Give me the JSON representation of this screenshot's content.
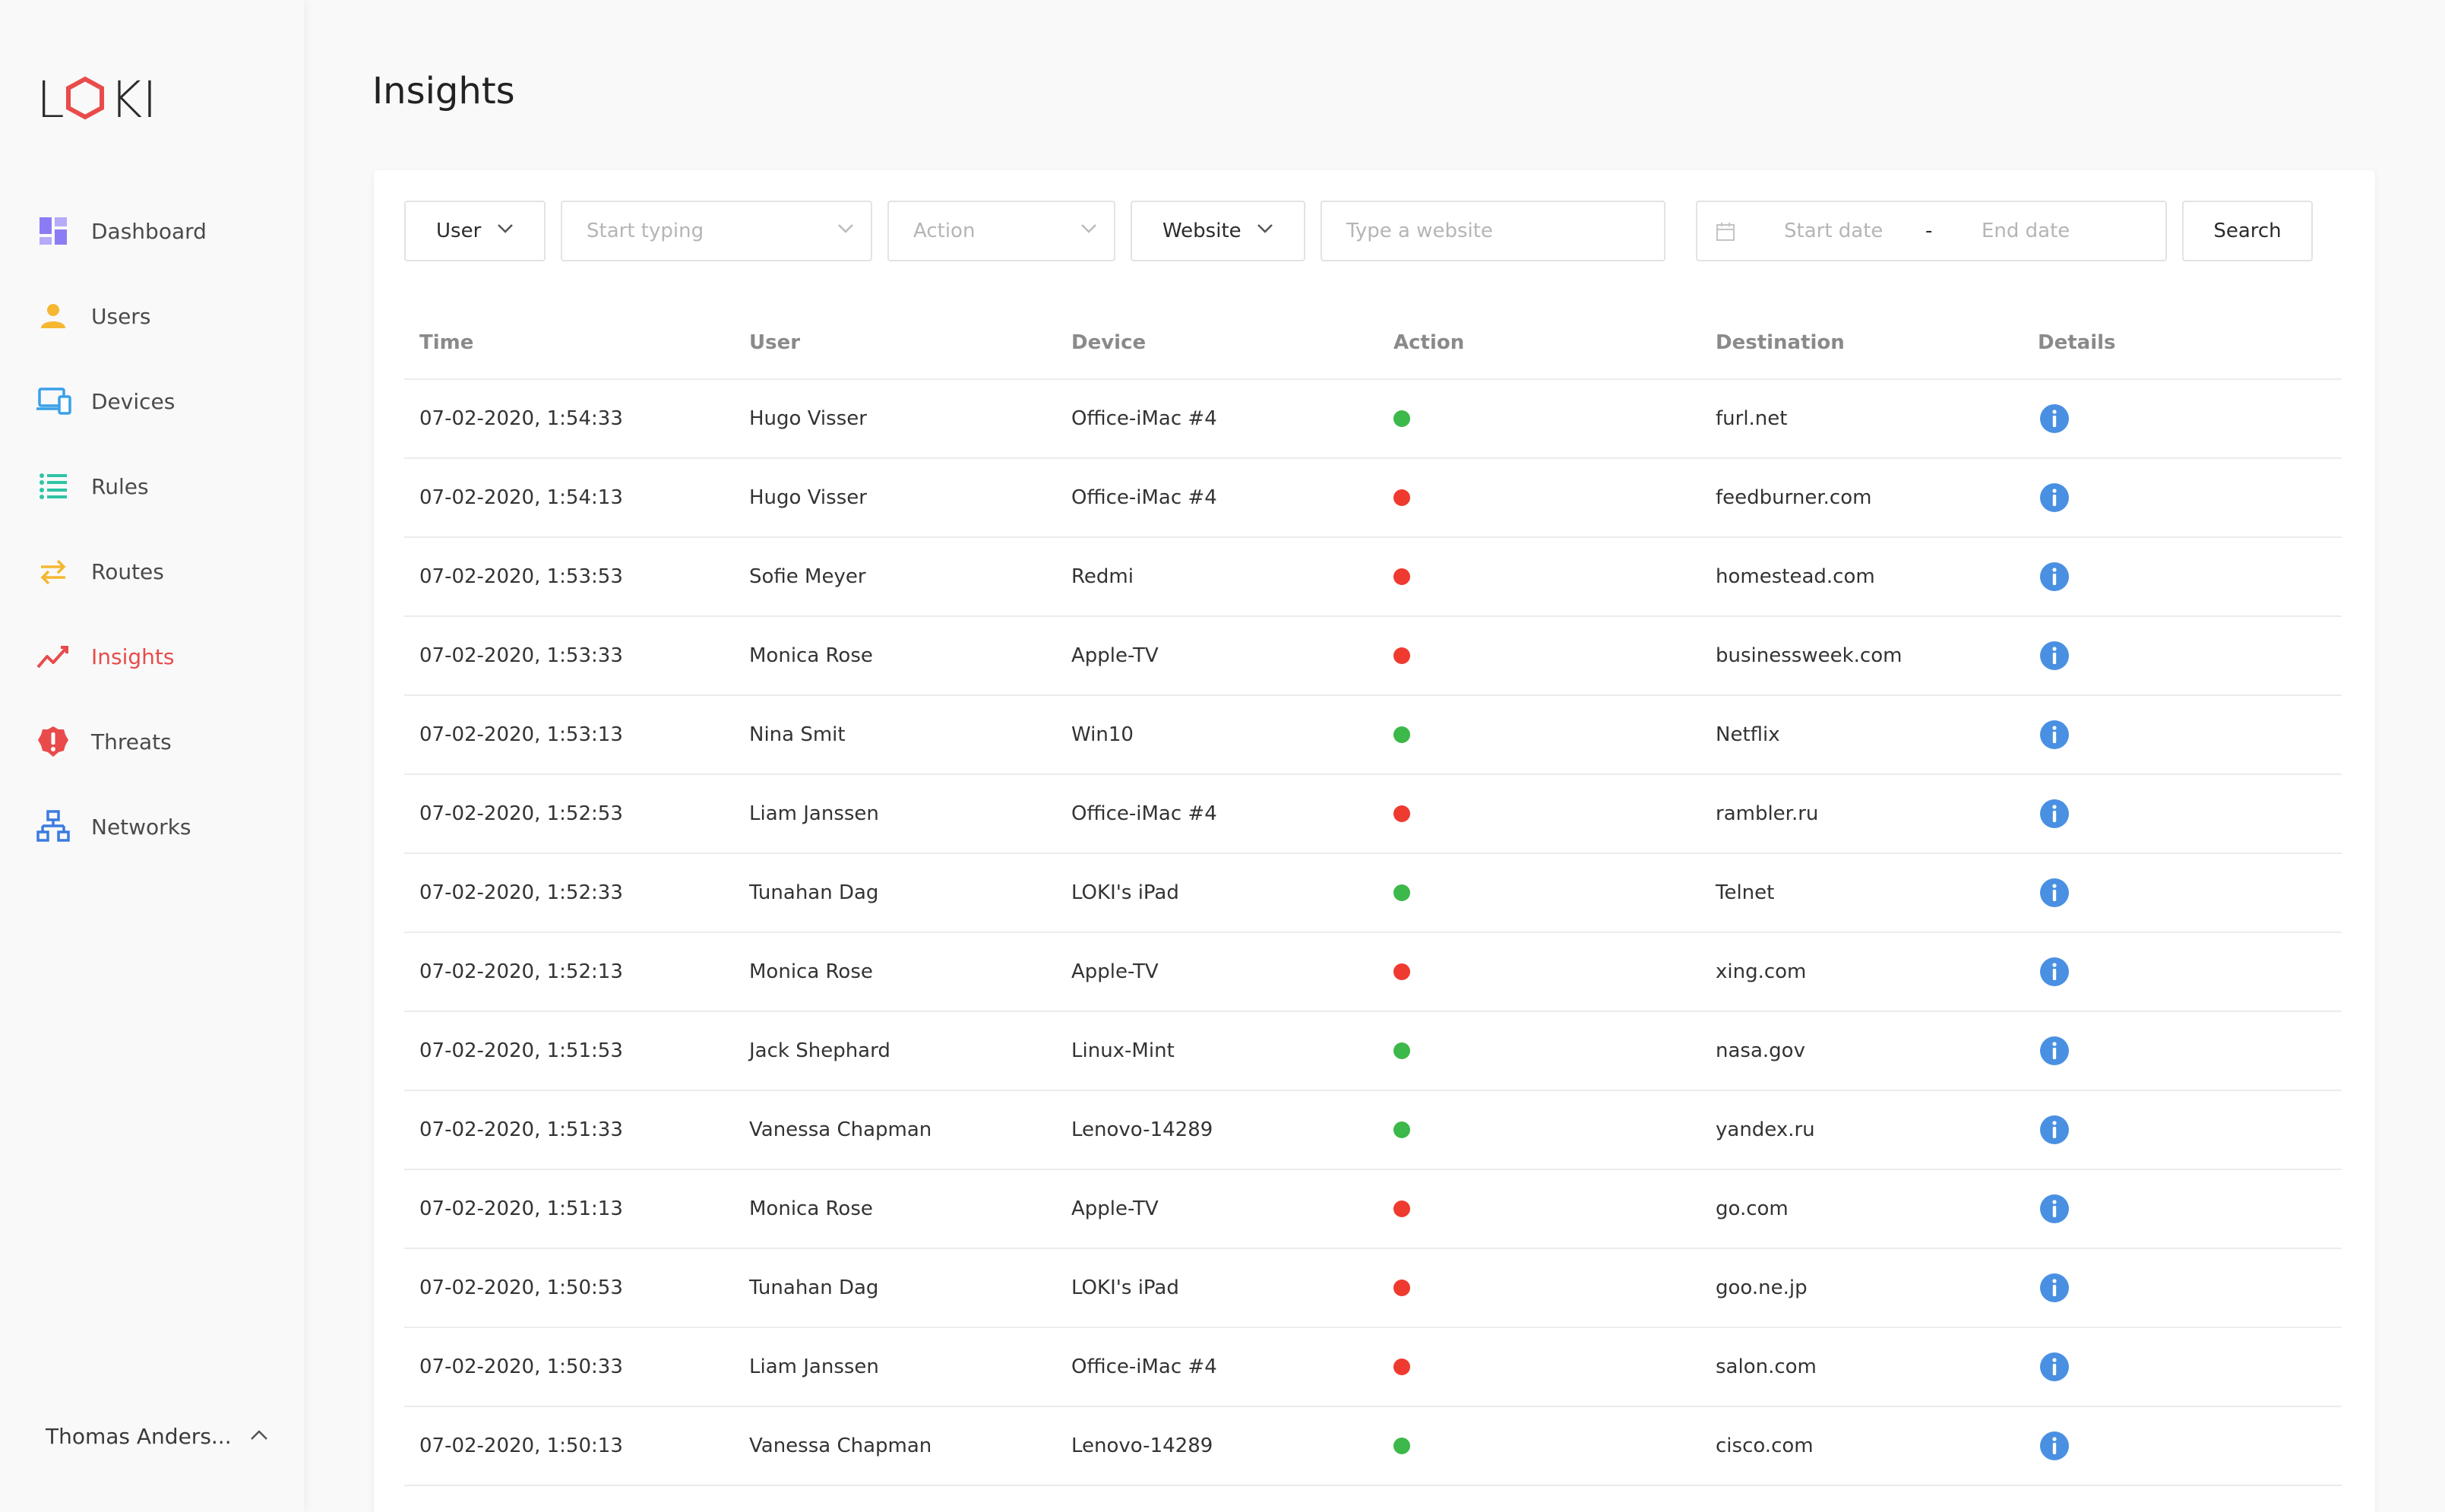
{
  "brand": {
    "logo_text": "LOKI"
  },
  "sidebar": {
    "items": [
      {
        "label": "Dashboard",
        "icon": "dashboard-icon",
        "color": "#8b7cf6"
      },
      {
        "label": "Users",
        "icon": "user-icon",
        "color": "#f5b731"
      },
      {
        "label": "Devices",
        "icon": "devices-icon",
        "color": "#3aa0e8"
      },
      {
        "label": "Rules",
        "icon": "list-icon",
        "color": "#2ec4a5"
      },
      {
        "label": "Routes",
        "icon": "routes-icon",
        "color": "#f5b731"
      },
      {
        "label": "Insights",
        "icon": "chart-line-icon",
        "color": "#e94b4b",
        "active": true
      },
      {
        "label": "Threats",
        "icon": "alert-icon",
        "color": "#e94b4b"
      },
      {
        "label": "Networks",
        "icon": "network-icon",
        "color": "#3b7be0"
      }
    ],
    "user_name": "Thomas Anders..."
  },
  "header": {
    "title": "Insights"
  },
  "filters": {
    "user_select": "User",
    "user_input_placeholder": "Start typing",
    "action_placeholder": "Action",
    "website_select": "Website",
    "website_input_placeholder": "Type a website",
    "start_date_placeholder": "Start date",
    "date_separator": "-",
    "end_date_placeholder": "End date",
    "search_label": "Search"
  },
  "table": {
    "columns": [
      "Time",
      "User",
      "Device",
      "Action",
      "Destination",
      "Details"
    ],
    "rows": [
      {
        "time": "07-02-2020, 1:54:33",
        "user": "Hugo Visser",
        "device": "Office-iMac #4",
        "action": "allowed",
        "destination": "furl.net"
      },
      {
        "time": "07-02-2020, 1:54:13",
        "user": "Hugo Visser",
        "device": "Office-iMac #4",
        "action": "blocked",
        "destination": "feedburner.com"
      },
      {
        "time": "07-02-2020, 1:53:53",
        "user": "Sofie Meyer",
        "device": "Redmi",
        "action": "blocked",
        "destination": "homestead.com"
      },
      {
        "time": "07-02-2020, 1:53:33",
        "user": "Monica Rose",
        "device": "Apple-TV",
        "action": "blocked",
        "destination": "businessweek.com"
      },
      {
        "time": "07-02-2020, 1:53:13",
        "user": "Nina Smit",
        "device": "Win10",
        "action": "allowed",
        "destination": "Netflix"
      },
      {
        "time": "07-02-2020, 1:52:53",
        "user": "Liam Janssen",
        "device": "Office-iMac #4",
        "action": "blocked",
        "destination": "rambler.ru"
      },
      {
        "time": "07-02-2020, 1:52:33",
        "user": "Tunahan Dag",
        "device": "LOKI's iPad",
        "action": "allowed",
        "destination": "Telnet"
      },
      {
        "time": "07-02-2020, 1:52:13",
        "user": "Monica Rose",
        "device": "Apple-TV",
        "action": "blocked",
        "destination": "xing.com"
      },
      {
        "time": "07-02-2020, 1:51:53",
        "user": "Jack Shephard",
        "device": "Linux-Mint",
        "action": "allowed",
        "destination": "nasa.gov"
      },
      {
        "time": "07-02-2020, 1:51:33",
        "user": "Vanessa Chapman",
        "device": "Lenovo-14289",
        "action": "allowed",
        "destination": "yandex.ru"
      },
      {
        "time": "07-02-2020, 1:51:13",
        "user": "Monica Rose",
        "device": "Apple-TV",
        "action": "blocked",
        "destination": "go.com"
      },
      {
        "time": "07-02-2020, 1:50:53",
        "user": "Tunahan Dag",
        "device": "LOKI's iPad",
        "action": "blocked",
        "destination": "goo.ne.jp"
      },
      {
        "time": "07-02-2020, 1:50:33",
        "user": "Liam Janssen",
        "device": "Office-iMac #4",
        "action": "blocked",
        "destination": "salon.com"
      },
      {
        "time": "07-02-2020, 1:50:13",
        "user": "Vanessa Chapman",
        "device": "Lenovo-14289",
        "action": "allowed",
        "destination": "cisco.com"
      }
    ]
  },
  "colors": {
    "accent": "#e94b4b",
    "allowed": "#3db84a",
    "blocked": "#ee3a2f",
    "info": "#4a90e2"
  }
}
